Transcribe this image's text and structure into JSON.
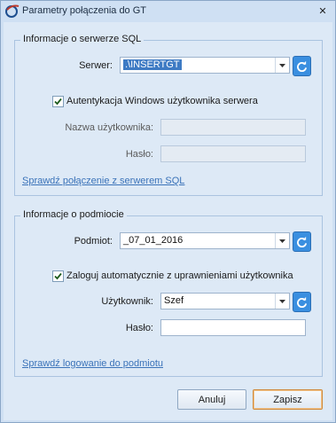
{
  "window": {
    "title": "Parametry połączenia do GT",
    "close_label": "✕"
  },
  "server_group": {
    "legend": "Informacje o serwerze SQL",
    "server_label": "Serwer:",
    "server_value": ".\\INSERTGT",
    "windows_auth_label": "Autentykacja Windows użytkownika serwera",
    "windows_auth_checked": true,
    "username_label": "Nazwa użytkownika:",
    "username_value": "",
    "password_label": "Hasło:",
    "password_value": "",
    "check_link": "Sprawdź połączenie z serwerem SQL"
  },
  "entity_group": {
    "legend": "Informacje o podmiocie",
    "entity_label": "Podmiot:",
    "entity_value": "_07_01_2016",
    "auto_login_label": "Zaloguj automatycznie z uprawnieniami użytkownika",
    "auto_login_checked": true,
    "user_label": "Użytkownik:",
    "user_value": "Szef",
    "password_label": "Hasło:",
    "password_value": "",
    "check_link": "Sprawdź logowanie do podmiotu"
  },
  "buttons": {
    "cancel": "Anuluj",
    "save": "Zapisz"
  },
  "colors": {
    "accent": "#3a8fe0",
    "link": "#3b73b9",
    "primary_border": "#d08a3c"
  }
}
